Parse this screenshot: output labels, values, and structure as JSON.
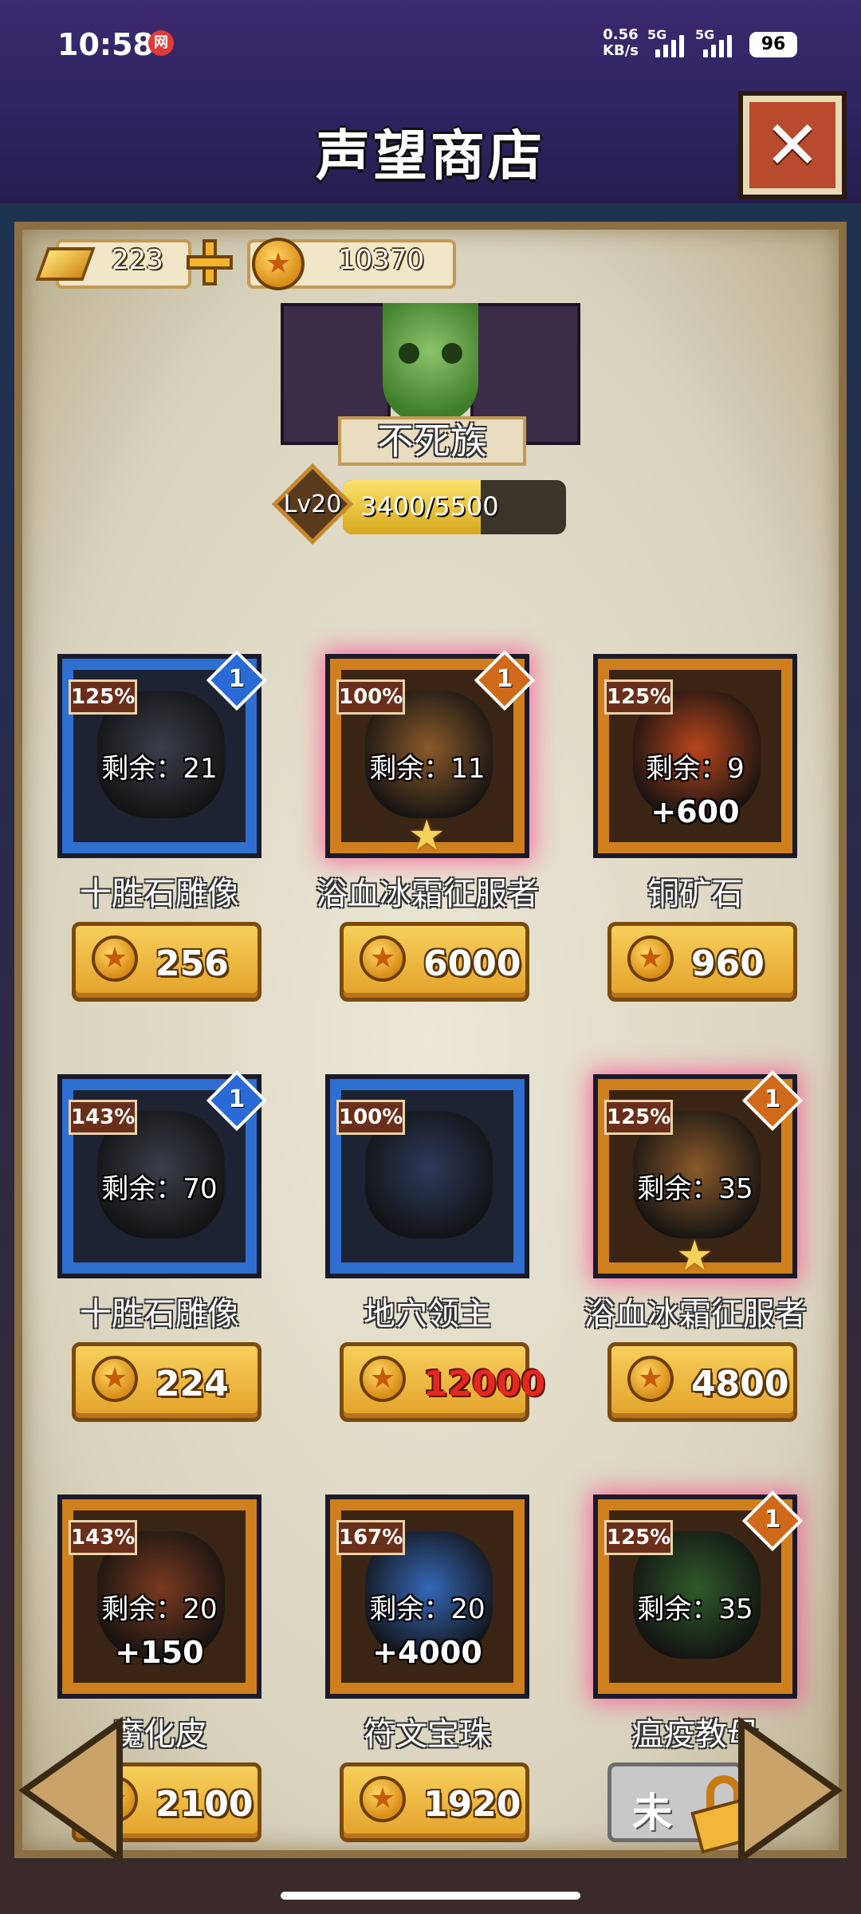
{
  "status_bar": {
    "time": "10:58",
    "app_icon": "网",
    "net_speed_value": "0.56",
    "net_speed_unit": "KB/s",
    "sim1": "5G",
    "sim2": "5G",
    "battery": "96"
  },
  "header": {
    "title": "声望商店",
    "close_icon": "✕"
  },
  "currency": {
    "gold_ingot": "223",
    "coins": "10370"
  },
  "faction": {
    "name": "不死族",
    "level": "Lv20",
    "xp_text": "3400/5500",
    "xp_progress": 0.618
  },
  "items": [
    {
      "discount": "125%",
      "tier": "1",
      "tier_color": "blue",
      "remaining": "剩余：21",
      "bonus": "",
      "name": "十胜石雕像",
      "price": "256",
      "frame": "blue",
      "glow": false,
      "star": false,
      "affordable": true,
      "art_color": "#3a3e4a"
    },
    {
      "discount": "100%",
      "tier": "1",
      "tier_color": "orange",
      "remaining": "剩余：11",
      "bonus": "",
      "name": "浴血冰霜征服者",
      "price": "6000",
      "frame": "orange",
      "glow": true,
      "star": true,
      "affordable": true,
      "art_color": "#8a5a2a"
    },
    {
      "discount": "125%",
      "tier": "",
      "tier_color": "",
      "remaining": "剩余：9",
      "bonus": "+600",
      "name": "铜矿石",
      "price": "960",
      "frame": "orange",
      "glow": false,
      "star": false,
      "affordable": true,
      "art_color": "#b8461c"
    },
    {
      "discount": "143%",
      "tier": "1",
      "tier_color": "blue",
      "remaining": "剩余：70",
      "bonus": "",
      "name": "十胜石雕像",
      "price": "224",
      "frame": "blue",
      "glow": false,
      "star": false,
      "affordable": true,
      "art_color": "#3a3e4a"
    },
    {
      "discount": "100%",
      "tier": "",
      "tier_color": "",
      "remaining": "",
      "bonus": "",
      "name": "地穴领主",
      "price": "12000",
      "frame": "blue",
      "glow": false,
      "star": false,
      "affordable": false,
      "art_color": "#2c3a5a"
    },
    {
      "discount": "125%",
      "tier": "1",
      "tier_color": "orange",
      "remaining": "剩余：35",
      "bonus": "",
      "name": "浴血冰霜征服者",
      "price": "4800",
      "frame": "orange",
      "glow": true,
      "star": true,
      "affordable": true,
      "art_color": "#8a5a2a"
    },
    {
      "discount": "143%",
      "tier": "",
      "tier_color": "",
      "remaining": "剩余：20",
      "bonus": "+150",
      "name": "魔化皮",
      "price": "2100",
      "frame": "orange",
      "glow": false,
      "star": false,
      "affordable": true,
      "art_color": "#7a3a1e"
    },
    {
      "discount": "167%",
      "tier": "",
      "tier_color": "",
      "remaining": "剩余：20",
      "bonus": "+4000",
      "name": "符文宝珠",
      "price": "1920",
      "frame": "orange",
      "glow": false,
      "star": false,
      "affordable": true,
      "art_color": "#3568b8"
    },
    {
      "discount": "125%",
      "tier": "1",
      "tier_color": "orange",
      "remaining": "剩余：35",
      "bonus": "",
      "name": "瘟疫教母",
      "price": "",
      "locked_label": "未",
      "frame": "orange",
      "glow": true,
      "star": false,
      "affordable": true,
      "art_color": "#2f5a2a"
    }
  ],
  "icons": {
    "star": "★",
    "coin": "★"
  }
}
